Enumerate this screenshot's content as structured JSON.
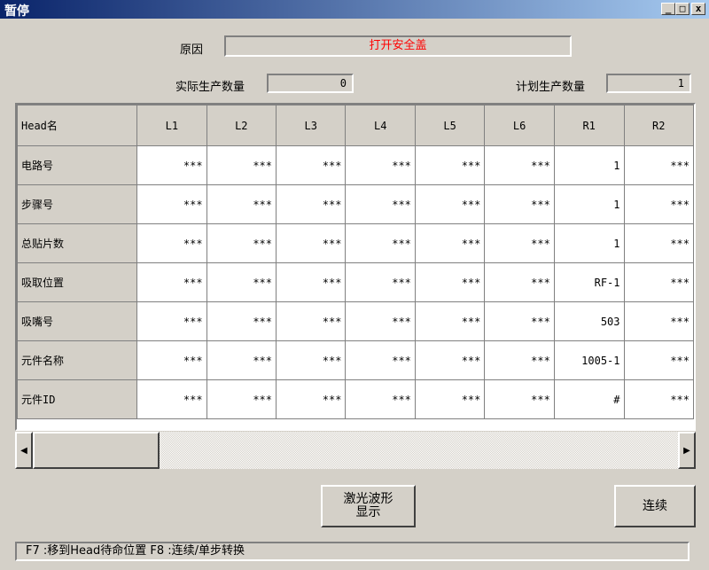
{
  "window": {
    "title": "暂停",
    "minimize": "_",
    "maximize": "□",
    "close": "x"
  },
  "reason": {
    "label": "原因",
    "value": "打开安全盖"
  },
  "counts": {
    "actual_label": "实际生产数量",
    "actual_value": "0",
    "planned_label": "计划生产数量",
    "planned_value": "1"
  },
  "table": {
    "corner": "Head名",
    "columns": [
      "L1",
      "L2",
      "L3",
      "L4",
      "L5",
      "L6",
      "R1",
      "R2"
    ],
    "rows": [
      {
        "label": "电路号",
        "cells": [
          "***",
          "***",
          "***",
          "***",
          "***",
          "***",
          "1",
          "***"
        ]
      },
      {
        "label": "步骤号",
        "cells": [
          "***",
          "***",
          "***",
          "***",
          "***",
          "***",
          "1",
          "***"
        ]
      },
      {
        "label": "总贴片数",
        "cells": [
          "***",
          "***",
          "***",
          "***",
          "***",
          "***",
          "1",
          "***"
        ]
      },
      {
        "label": "吸取位置",
        "cells": [
          "***",
          "***",
          "***",
          "***",
          "***",
          "***",
          "RF-1",
          "***"
        ]
      },
      {
        "label": "吸嘴号",
        "cells": [
          "***",
          "***",
          "***",
          "***",
          "***",
          "***",
          "503",
          "***"
        ]
      },
      {
        "label": "元件名称",
        "cells": [
          "***",
          "***",
          "***",
          "***",
          "***",
          "***",
          "1005-1",
          "***"
        ]
      },
      {
        "label": "元件ID",
        "cells": [
          "***",
          "***",
          "***",
          "***",
          "***",
          "***",
          "#",
          "***"
        ]
      }
    ]
  },
  "buttons": {
    "laser": "激光波形\n显示",
    "continue": "连续"
  },
  "status": "F7 :移到Head待命位置  F8 :连续/单步转换"
}
